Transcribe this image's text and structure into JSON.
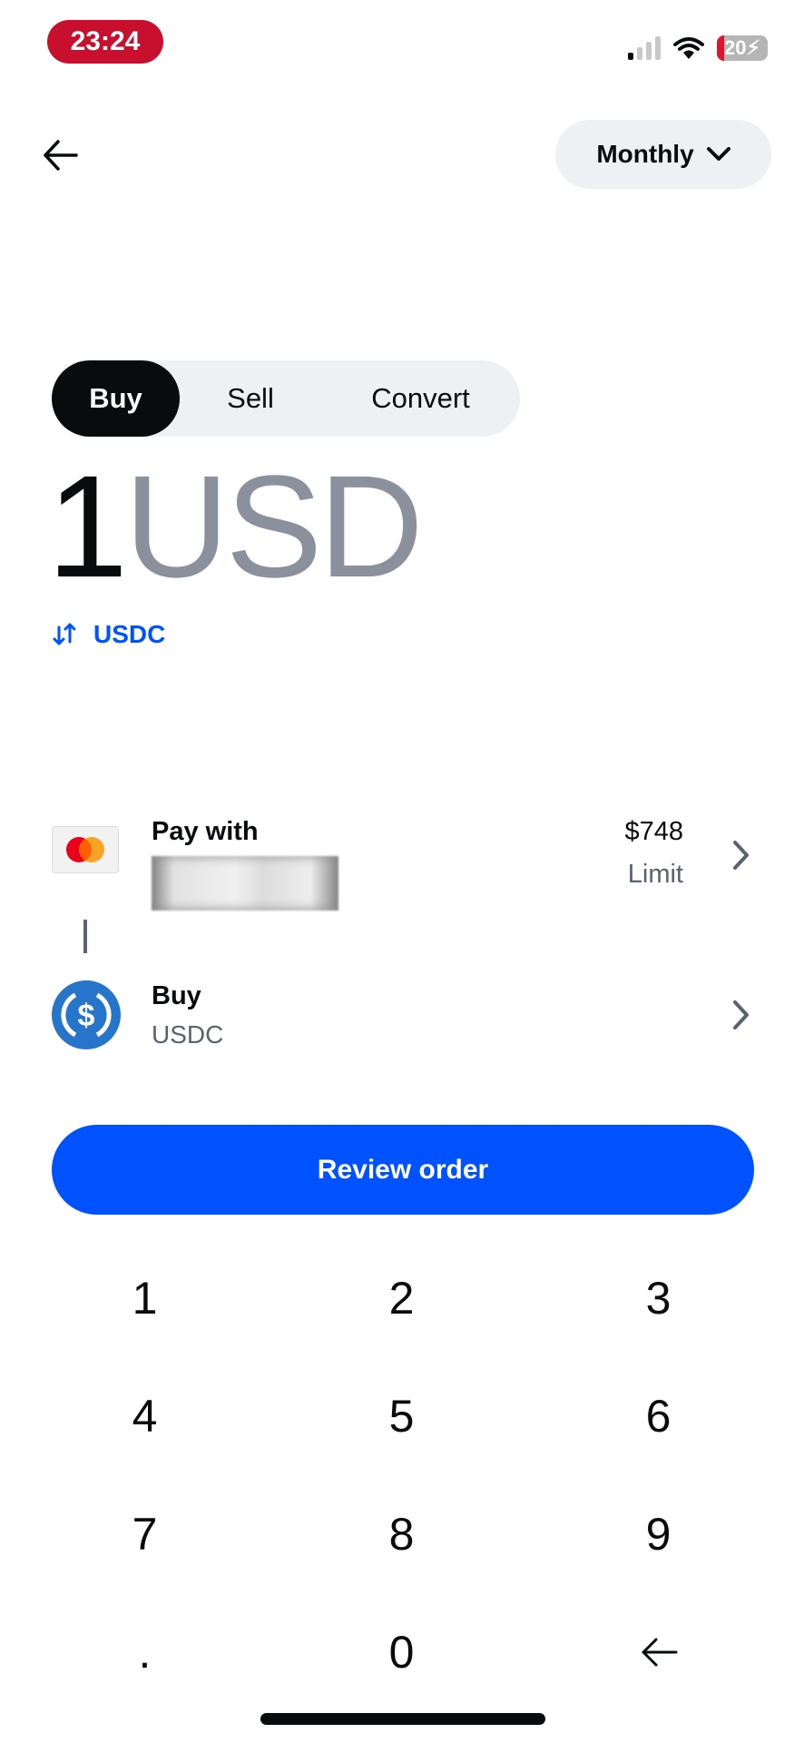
{
  "status_bar": {
    "time": "23:24",
    "battery_percent": "20",
    "signal_bars_active": 1,
    "signal_bars_total": 4,
    "colors": {
      "time_pill": "#c8102e",
      "battery": "#b5b5b5"
    }
  },
  "header": {
    "back_icon": "arrow-left-icon",
    "frequency_label": "Monthly",
    "frequency_icon": "chevron-down-icon"
  },
  "tabs": [
    {
      "label": "Buy",
      "active": true
    },
    {
      "label": "Sell",
      "active": false
    },
    {
      "label": "Convert",
      "active": false
    }
  ],
  "amount": {
    "value": "1",
    "currency": "USD"
  },
  "currency_toggle": {
    "icon": "swap-arrows-icon",
    "label": "USDC"
  },
  "pay_with": {
    "title": "Pay with",
    "method_redacted": true,
    "icon": "mastercard-icon",
    "limit_value": "$748",
    "limit_label": "Limit"
  },
  "buy_asset": {
    "title": "Buy",
    "asset": "USDC",
    "icon": "usdc-coin-icon"
  },
  "review_button": {
    "label": "Review order",
    "color": "#0052ff"
  },
  "keypad": {
    "keys": [
      "1",
      "2",
      "3",
      "4",
      "5",
      "6",
      "7",
      "8",
      "9",
      ".",
      "0",
      "←"
    ]
  }
}
